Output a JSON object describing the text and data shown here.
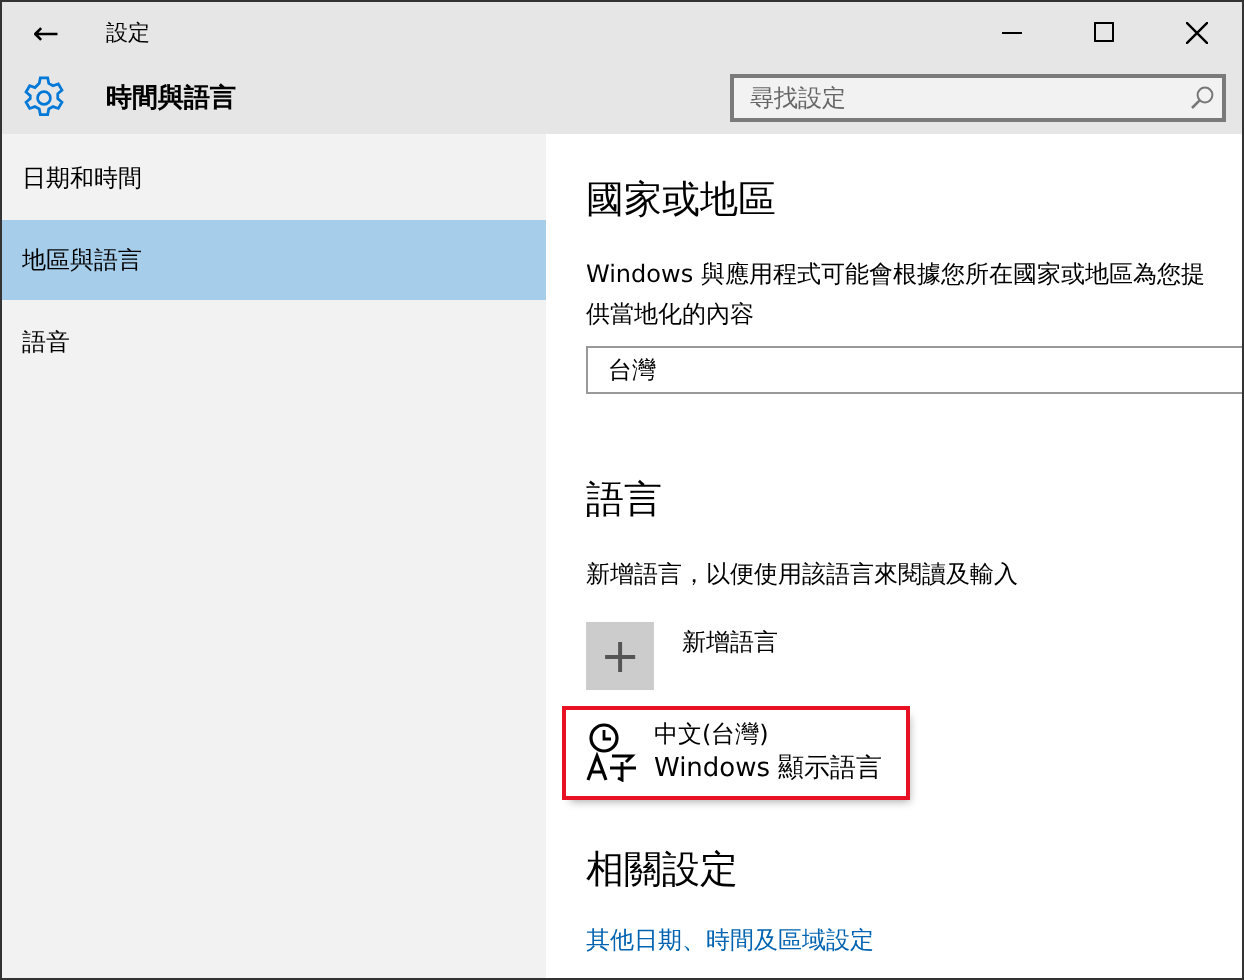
{
  "window": {
    "title": "設定",
    "back": "←"
  },
  "header": {
    "title": "時間與語言",
    "search": {
      "placeholder": "尋找設定"
    }
  },
  "sidebar": {
    "items": [
      {
        "label": "日期和時間",
        "selected": false
      },
      {
        "label": "地區與語言",
        "selected": true
      },
      {
        "label": "語音",
        "selected": false
      }
    ]
  },
  "region": {
    "heading": "國家或地區",
    "description": "Windows 與應用程式可能會根據您所在國家或地區為您提供當地化的內容",
    "country": "台灣"
  },
  "languages": {
    "heading": "語言",
    "description": "新增語言，以便使用該語言來閱讀及輸入",
    "add": {
      "icon": "+",
      "label": "新增語言"
    },
    "items": [
      {
        "name": "中文(台灣)",
        "detail": "Windows 顯示語言",
        "highlighted": true
      }
    ]
  },
  "related": {
    "heading": "相關設定",
    "links": [
      "其他日期、時間及區域設定"
    ]
  }
}
